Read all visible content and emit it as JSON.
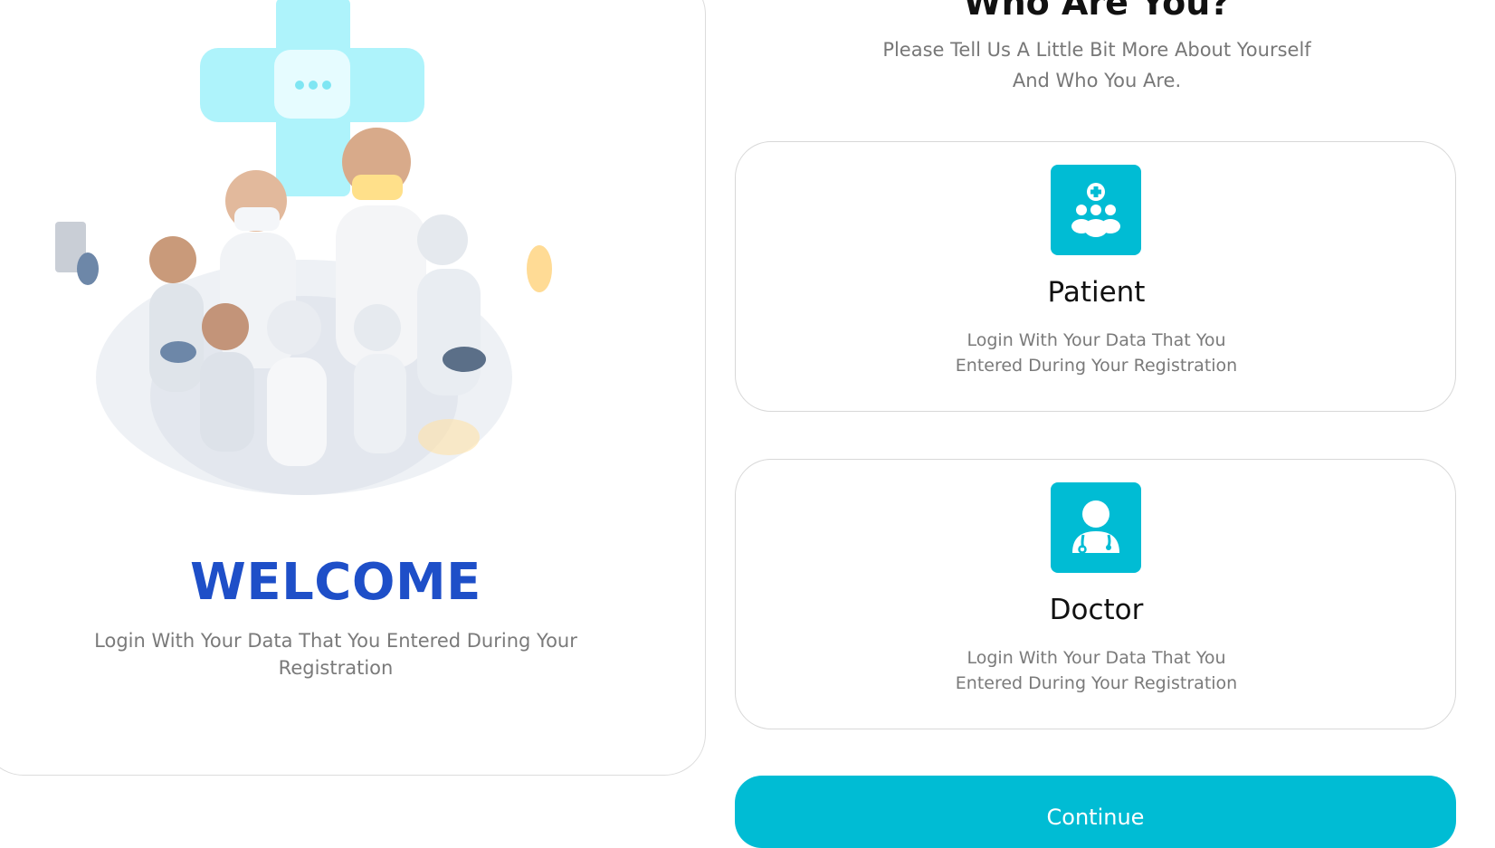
{
  "welcome": {
    "title": "WELCOME",
    "subtitle": "Login With Your Data That You Entered During Your Registration"
  },
  "selection": {
    "heading": "Who Are You?",
    "subheading": "Please Tell Us A Little Bit More About Yourself And Who You Are."
  },
  "cards": [
    {
      "title": "Patient",
      "description": "Login With Your Data That You Entered During Your Registration",
      "icon": "patients-group-icon"
    },
    {
      "title": "Doctor",
      "description": "Login With Your Data That You Entered During Your Registration",
      "icon": "doctor-icon"
    }
  ],
  "action": {
    "label": "Continue"
  },
  "colors": {
    "accent": "#00bcd4",
    "welcome_title": "#1e4fc8",
    "hero_cross": "#aef3fb",
    "muted_text": "#777777"
  }
}
